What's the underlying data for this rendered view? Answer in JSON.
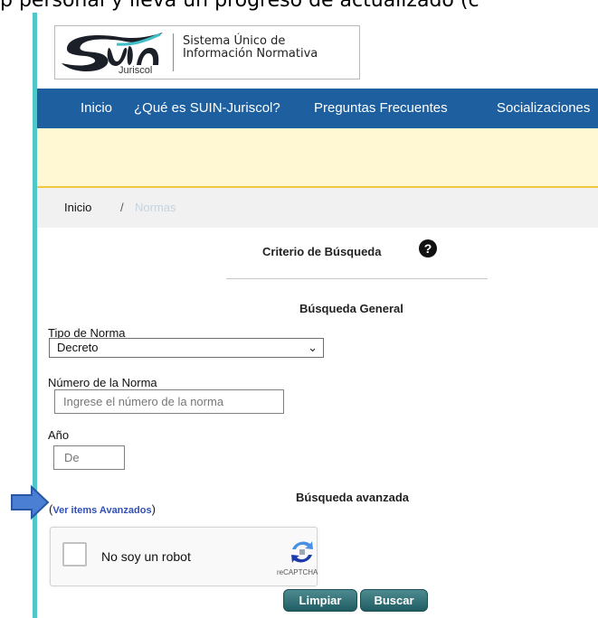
{
  "caption": "p personal y lleva un progreso de actualizado (c",
  "header": {
    "logo": {
      "wordmark": "Suin",
      "subtitle": "Juriscol",
      "title_line1": "Sistema Único de",
      "title_line2": "Información Normativa"
    }
  },
  "nav": {
    "items": [
      "Inicio",
      "¿Qué es SUIN-Juriscol?",
      "Preguntas Frecuentes",
      "Socializaciones"
    ]
  },
  "breadcrumb": {
    "home": "Inicio",
    "separator": "/",
    "current": "Normas"
  },
  "search": {
    "criteria_title": "Criterio de Búsqueda",
    "help_icon": "question-circle-icon",
    "general_title": "Búsqueda General",
    "norm_type": {
      "label": "Tipo de Norma",
      "selected": "Decreto"
    },
    "norm_number": {
      "label": "Número de la Norma",
      "placeholder": "Ingrese el número de la norma"
    },
    "year": {
      "label": "Año",
      "placeholder": "De"
    },
    "advanced_link": {
      "prefix": "(",
      "label": "Ver items Avanzados",
      "suffix": ")"
    },
    "advanced_title": "Búsqueda avanzada",
    "captcha": {
      "label": "No soy un robot",
      "brand": "reCAPTCHA"
    },
    "buttons": {
      "clear": "Limpiar",
      "search": "Buscar"
    }
  },
  "colors": {
    "nav": "#1e5f9f",
    "accent": "#52c7c9",
    "buttons": "#2b6a70"
  }
}
